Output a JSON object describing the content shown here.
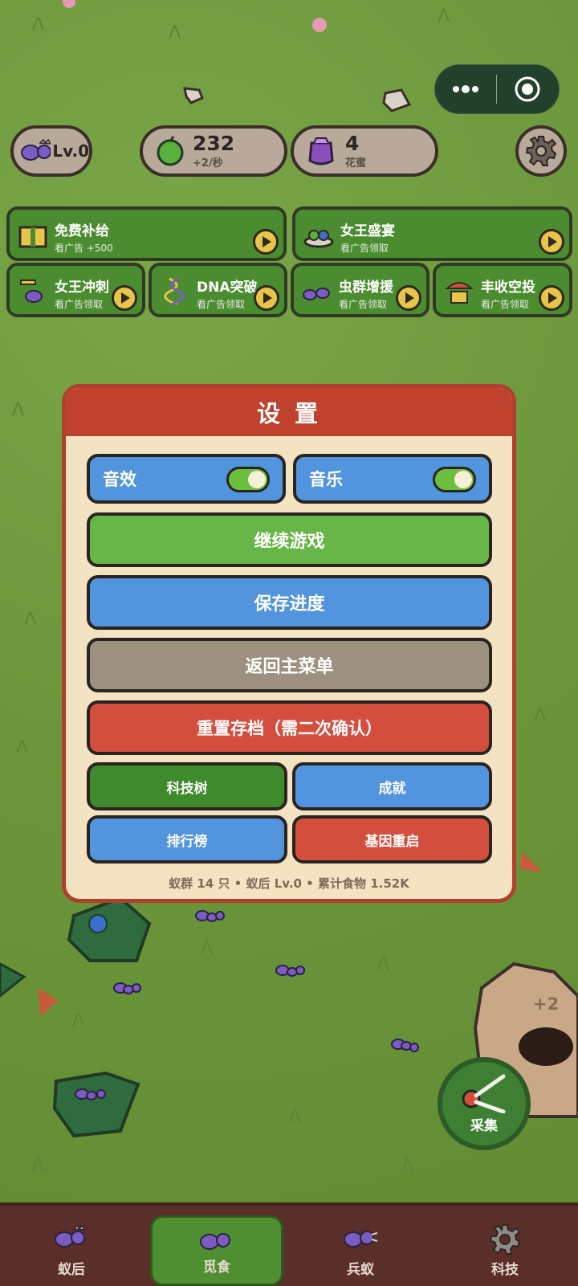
{
  "hud": {
    "level": "Lv.0",
    "food_value": "232",
    "food_rate": "+2/秒",
    "nectar_value": "4",
    "nectar_label": "花蜜"
  },
  "rewards": [
    {
      "title": "免费补给",
      "sub": "看广告 +500"
    },
    {
      "title": "女王盛宴",
      "sub": "看广告领取"
    },
    {
      "title": "女王冲刺",
      "sub": "看广告领取"
    },
    {
      "title": "DNA突破",
      "sub": "看广告领取"
    },
    {
      "title": "虫群增援",
      "sub": "看广告领取"
    },
    {
      "title": "丰收空投",
      "sub": "看广告领取"
    }
  ],
  "settings": {
    "title": "设 置",
    "sound_label": "音效",
    "sound_on": true,
    "music_label": "音乐",
    "music_on": true,
    "continue_label": "继续游戏",
    "save_label": "保存进度",
    "menu_label": "返回主菜单",
    "reset_label": "重置存档（需二次确认）",
    "tech_label": "科技树",
    "achieve_label": "成就",
    "rank_label": "排行榜",
    "gene_label": "基因重启",
    "stats": "蚁群 14 只 • 蚁后 Lv.0 • 累计食物 1.52K"
  },
  "field": {
    "plus_text": "+2",
    "collect_label": "采集"
  },
  "tabs": [
    {
      "label": "蚁后",
      "icon": "queen-ant-icon"
    },
    {
      "label": "觅食",
      "icon": "worker-ant-icon",
      "active": true
    },
    {
      "label": "兵蚁",
      "icon": "soldier-ant-icon"
    },
    {
      "label": "科技",
      "icon": "gear-icon"
    }
  ],
  "colors": {
    "accent_red": "#c0412e",
    "blue_btn": "#5294de",
    "green_btn": "#68b548",
    "gray_btn": "#9c9180"
  }
}
